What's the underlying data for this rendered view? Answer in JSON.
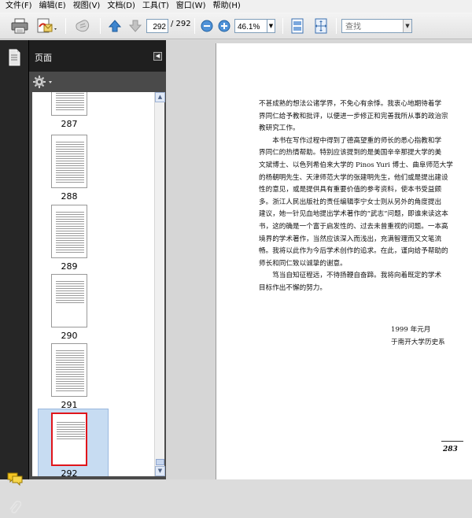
{
  "menu": {
    "items": [
      "文件(F)",
      "编辑(E)",
      "视图(V)",
      "文档(D)",
      "工具(T)",
      "窗口(W)",
      "帮助(H)"
    ]
  },
  "toolbar": {
    "page_current": "292",
    "page_total": "/ 292",
    "zoom_value": "46.1%",
    "find_placeholder": "查找",
    "icons": [
      "print-icon",
      "email-icon",
      "hand-icon",
      "previous-page-icon",
      "next-page-icon",
      "zoom-out-icon",
      "zoom-in-icon",
      "fit-page-icon",
      "fullscreen-icon"
    ]
  },
  "panel": {
    "title": "页面",
    "thumbnails": [
      {
        "label": "287"
      },
      {
        "label": "288"
      },
      {
        "label": "289"
      },
      {
        "label": "290"
      },
      {
        "label": "291"
      },
      {
        "label": "292",
        "selected": true
      }
    ]
  },
  "page": {
    "lines": [
      "不甚成熟的想法公诸学界，不免心有余悸。我衷心地期待着学",
      "界同仁给予教和批评，以便进一步修正和完善我所从事的政治宗",
      "教研究工作。",
      "　　本书在写作过程中得到了德高望重的师长的悉心指教和学",
      "界同仁的热情帮助。特别应该提到的是美国辛辛那提大学的美",
      "文斌博士、以色列希伯来大学的 Pinos Yuri 博士、曲阜师范大学",
      "的杨朝明先生、天津师范大学的张建明先生，他们或是提出建设",
      "性的意见，或是提供具有重要价值的参考资料，使本书受益颇",
      "多。浙江人民出版社的责任编辑李宁女士则从另外的角度提出",
      "建议，她一针见血地提出学术著作的“武志”问题，即谁来读这本",
      "书，这的确是一个富于启发性的、过去未曾重视的问题。一本高",
      "境界的学术著作，当然应该深入而浅出，充满智理而又文笔流",
      "畅。我将以此作为今后学术创作的追求。在此，谨向给予帮助的",
      "师长和同仁致以诚挚的谢意。",
      "　　笃当自知征程远，不待扬鞭自奋蹄。我将向着既定的学术",
      "目标作出不懈的努力。"
    ],
    "sign_date": "1999 年元月",
    "sign_place": "于南开大学历史系",
    "page_number": "283"
  }
}
